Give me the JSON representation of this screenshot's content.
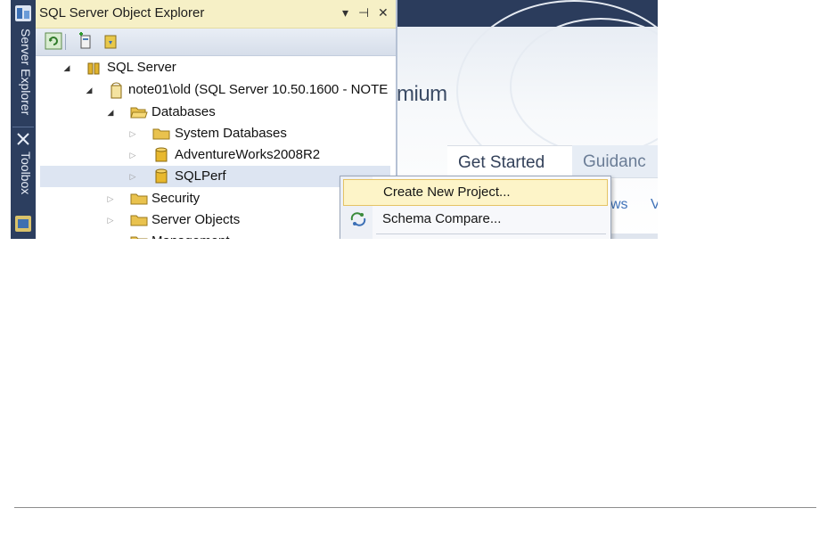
{
  "background": {
    "product_suffix": "mium",
    "tabs": [
      "Get Started",
      "Guidanc"
    ],
    "link_fragments": [
      "ws",
      "V"
    ]
  },
  "dock": {
    "tabs": [
      "Server Explorer",
      "Toolbox"
    ]
  },
  "panel": {
    "title": "SQL Server Object Explorer",
    "controls": {
      "dropdown": "▾",
      "pin": "⊣",
      "close": "✕"
    },
    "toolbar_icons": [
      "refresh-icon",
      "add-server-icon",
      "filter-icon"
    ]
  },
  "tree": {
    "items": [
      {
        "label": "SQL Server",
        "state": "expanded",
        "icon": "sql-server-icon"
      },
      {
        "label": "note01\\old (SQL Server 10.50.1600 - NOTE",
        "state": "expanded",
        "icon": "server-instance-icon"
      },
      {
        "label": "Databases",
        "state": "expanded",
        "icon": "folder-open-icon"
      },
      {
        "label": "System Databases",
        "state": "collapsed",
        "icon": "folder-icon"
      },
      {
        "label": "AdventureWorks2008R2",
        "state": "collapsed",
        "icon": "database-icon"
      },
      {
        "label": "SQLPerf",
        "state": "collapsed",
        "icon": "database-icon",
        "selected": true
      },
      {
        "label": "Security",
        "state": "collapsed",
        "icon": "folder-icon"
      },
      {
        "label": "Server Objects",
        "state": "collapsed",
        "icon": "folder-icon"
      },
      {
        "label": "Management",
        "state": "collapsed",
        "icon": "folder-icon"
      }
    ]
  },
  "context_menu": {
    "items": [
      {
        "label": "Create New Project...",
        "icon": "",
        "highlighted": true
      },
      {
        "label": "Schema Compare...",
        "icon": "schema-compare-icon"
      }
    ]
  },
  "colors": {
    "title_bar": "#f6f0c6",
    "dock": "#2c3e5f",
    "menu_highlight": "#fdf4c8"
  }
}
